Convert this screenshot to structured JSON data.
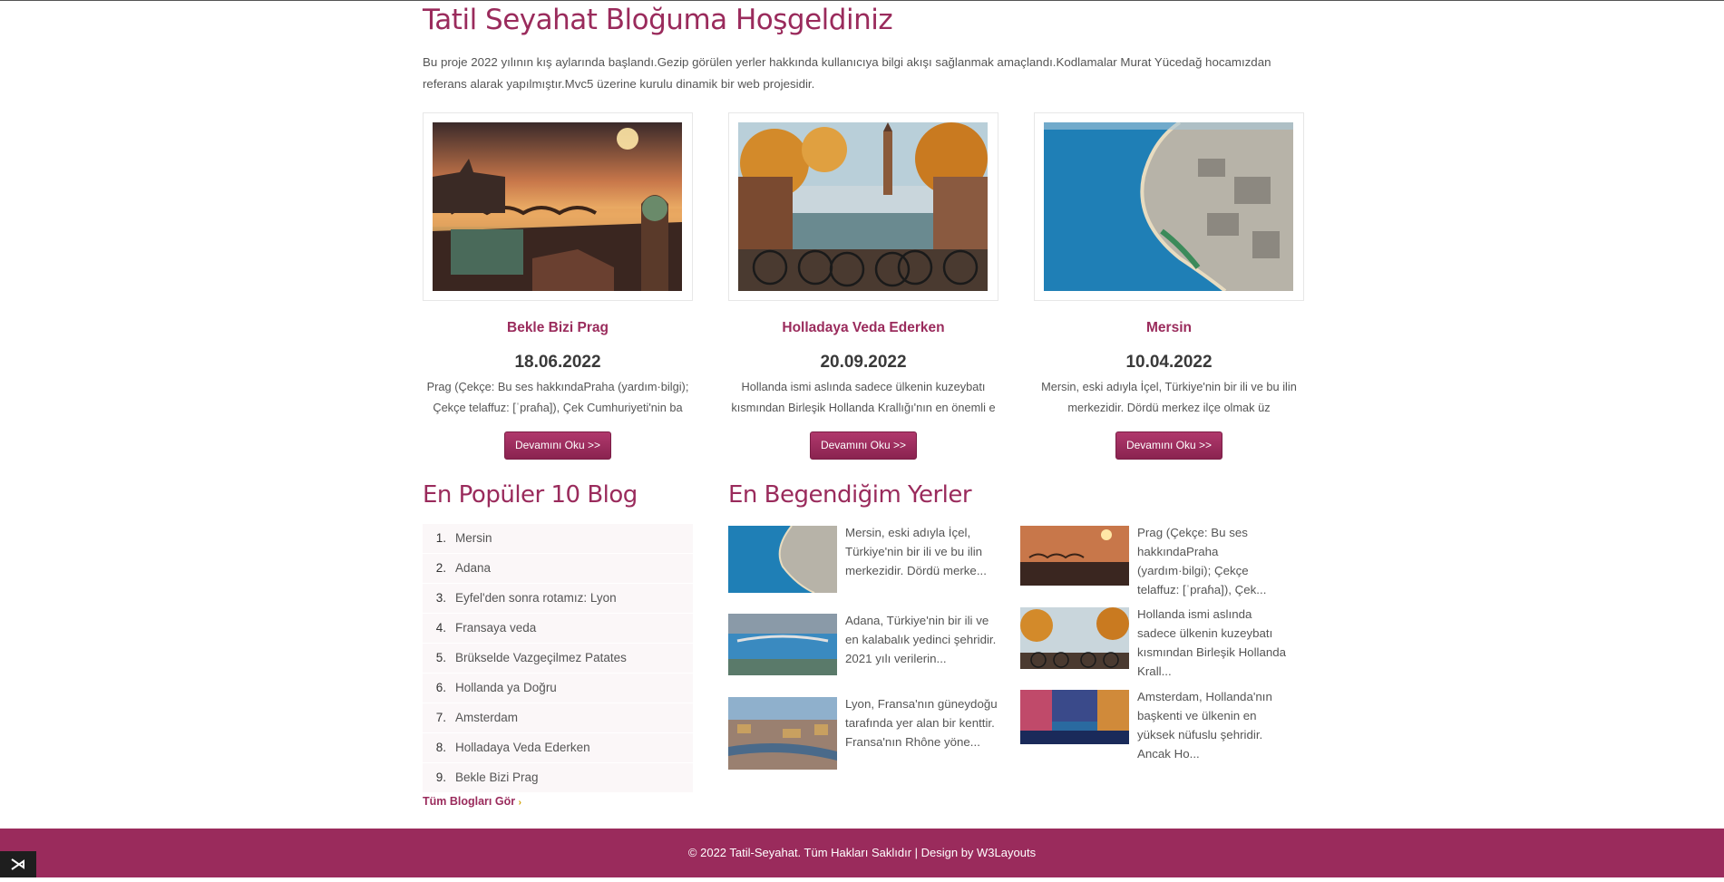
{
  "header": {
    "title": "Tatil Seyahat Bloğuma Hoşgeldiniz",
    "intro": "Bu proje 2022 yılının kış aylarında başlandı.Gezip görülen yerler hakkında kullanıcıya bilgi akışı sağlanmak amaçlandı.Kodlamalar Murat Yücedağ hocamızdan referans alarak yapılmıştır.Mvc5 üzerine kurulu dinamik bir web projesidir."
  },
  "cards": [
    {
      "title": "Bekle Bizi Prag",
      "date": "18.06.2022",
      "excerpt": "Prag (Çekçe: Bu ses hakkındaPraha (yardım·bilgi); Çekçe telaffuz: [ˈpraɦa]), Çek Cumhuriyeti'nin ba",
      "button": "Devamını Oku >>",
      "image": "prague-sunset-bridges"
    },
    {
      "title": "Holladaya Veda Ederken",
      "date": "20.09.2022",
      "excerpt": "Hollanda ismi aslında sadece ülkenin kuzeybatı kısmından Birleşik Hollanda Krallığı'nın en önemli e",
      "button": "Devamını Oku >>",
      "image": "amsterdam-canal-bicycles"
    },
    {
      "title": "Mersin",
      "date": "10.04.2022",
      "excerpt": "Mersin, eski adıyla İçel, Türkiye'nin bir ili ve bu ilin merkezidir. Dördü merkez ilçe olmak üz",
      "button": "Devamını Oku >>",
      "image": "mersin-coastline-aerial"
    }
  ],
  "popular": {
    "heading": "En Popüler 10 Blog",
    "items": [
      {
        "num": "1.",
        "label": "Mersin"
      },
      {
        "num": "2.",
        "label": "Adana"
      },
      {
        "num": "3.",
        "label": "Eyfel'den sonra rotamız: Lyon"
      },
      {
        "num": "4.",
        "label": "Fransaya veda"
      },
      {
        "num": "5.",
        "label": "Brükselde Vazgeçilmez Patates"
      },
      {
        "num": "6.",
        "label": "Hollanda ya Doğru"
      },
      {
        "num": "7.",
        "label": "Amsterdam"
      },
      {
        "num": "8.",
        "label": "Holladaya Veda Ederken"
      },
      {
        "num": "9.",
        "label": "Bekle Bizi Prag"
      }
    ],
    "all_link": "Tüm Blogları Gör",
    "all_link_arrow": "›"
  },
  "favorites": {
    "heading": "En Begendiğim Yerler",
    "left": [
      {
        "text": "Mersin, eski adıyla İçel, Türkiye'nin bir ili ve bu ilin merkezidir. Dördü merke...",
        "image": "mersin-coastline-aerial"
      },
      {
        "text": "Adana, Türkiye'nin bir ili ve en kalabalık yedinci şehridir. 2021 yılı verilerin...",
        "image": "adana-river-bridge"
      },
      {
        "text": "Lyon, Fransa'nın güneydoğu tarafında yer alan bir kenttir. Fransa'nın Rhône yöne...",
        "image": "lyon-city-river"
      }
    ],
    "right": [
      {
        "text": "Prag (Çekçe: Bu ses hakkındaPraha (yardım·bilgi); Çekçe telaffuz: [ˈpraɦa]), Çek...",
        "image": "prague-sunset-bridges"
      },
      {
        "text": "Hollanda ismi aslında sadece ülkenin kuzeybatı kısmından Birleşik Hollanda Krall...",
        "image": "amsterdam-canal-bicycles"
      },
      {
        "text": "Amsterdam, Hollanda'nın başkenti ve ülkenin en yüksek nüfuslu şehridir. Ancak Ho...",
        "image": "amsterdam-canal-night"
      }
    ]
  },
  "footer": {
    "text": "© 2022 Tatil-Seyahat. Tüm Hakları Saklıdır | Design by W3Layouts"
  },
  "colors": {
    "accent": "#9a2b5c",
    "footer_bg": "#9a2b5c"
  },
  "icons": {
    "corner_badge": "visual-studio-icon"
  }
}
